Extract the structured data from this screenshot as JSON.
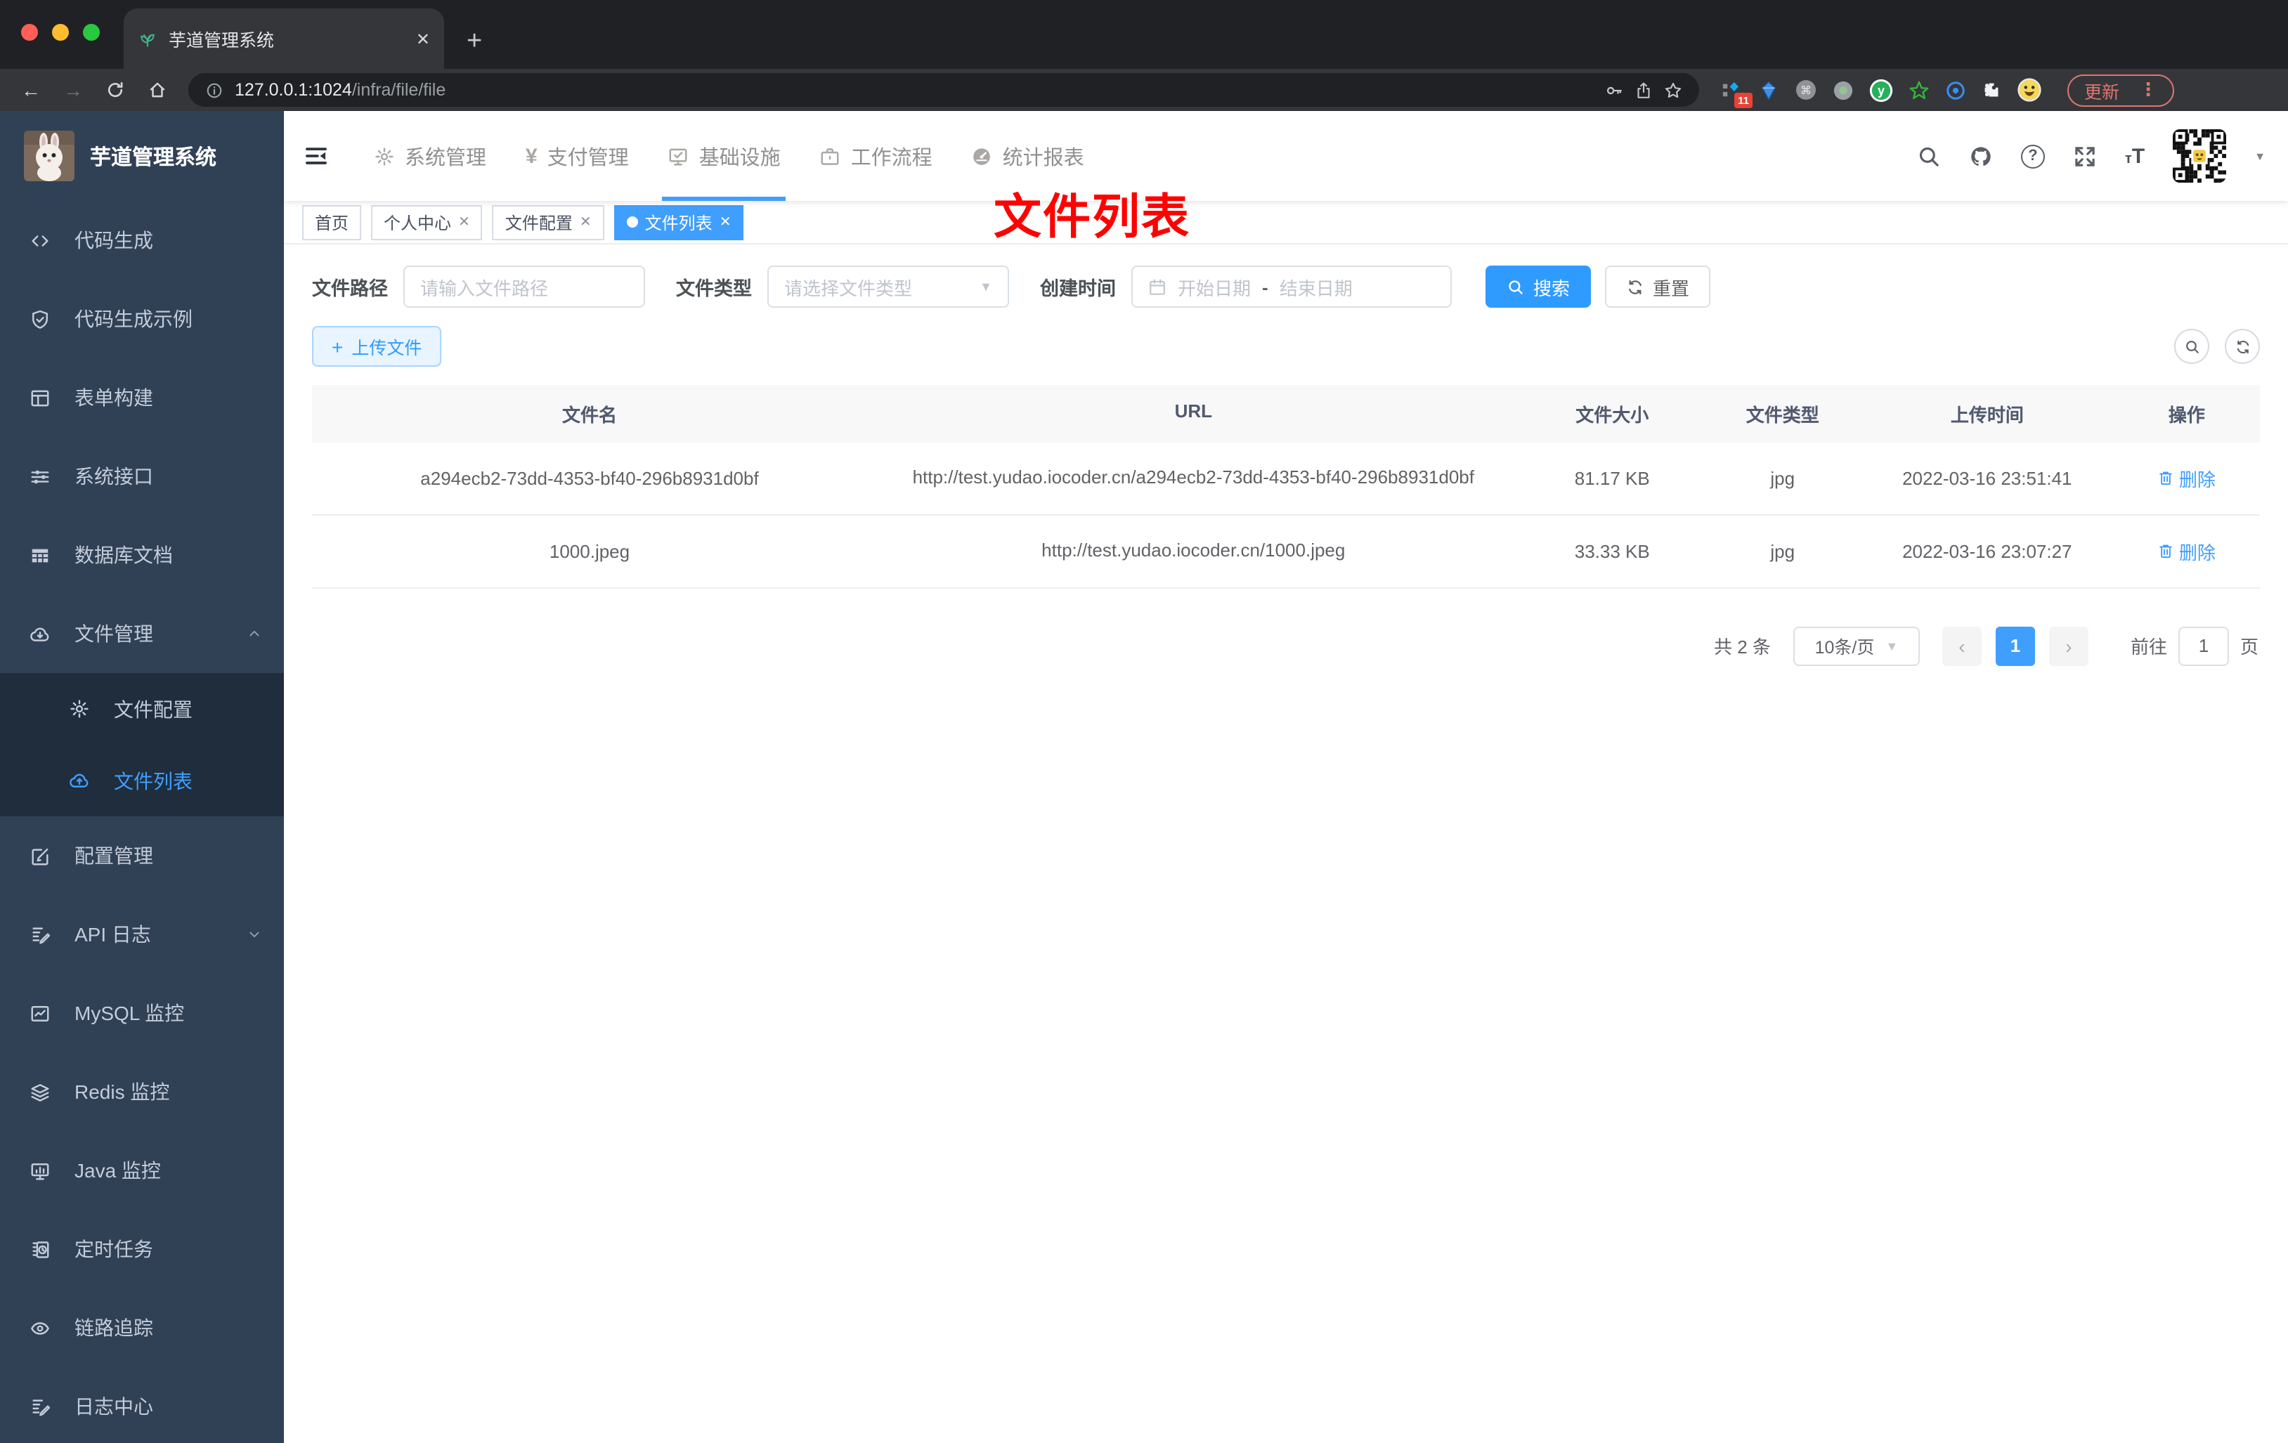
{
  "browser": {
    "tab_title": "芋道管理系统",
    "url_host": "127.0.0.1:1024",
    "url_path": "/infra/file/file",
    "ext_badge": "11",
    "update_label": "更新",
    "traffic_colors": [
      "#ff5f57",
      "#febc2e",
      "#28c840"
    ]
  },
  "sidebar": {
    "title": "芋道管理系统",
    "items": [
      {
        "id": "code-gen",
        "label": "代码生成",
        "icon": "code-icon"
      },
      {
        "id": "code-demo",
        "label": "代码生成示例",
        "icon": "shield-check-icon"
      },
      {
        "id": "form-build",
        "label": "表单构建",
        "icon": "form-icon"
      },
      {
        "id": "sys-api",
        "label": "系统接口",
        "icon": "sliders-icon"
      },
      {
        "id": "db-doc",
        "label": "数据库文档",
        "icon": "grid-icon"
      },
      {
        "id": "file-mgr",
        "label": "文件管理",
        "icon": "cloud-download-icon",
        "chevron": "up",
        "children": [
          {
            "id": "file-config",
            "label": "文件配置",
            "icon": "gear-icon"
          },
          {
            "id": "file-list",
            "label": "文件列表",
            "icon": "cloud-upload-icon",
            "active": true
          }
        ]
      },
      {
        "id": "config-mgr",
        "label": "配置管理",
        "icon": "edit-icon"
      },
      {
        "id": "api-log",
        "label": "API 日志",
        "icon": "log-edit-icon",
        "chevron": "down"
      },
      {
        "id": "mysql",
        "label": "MySQL 监控",
        "icon": "chart-box-icon"
      },
      {
        "id": "redis",
        "label": "Redis 监控",
        "icon": "layers-icon"
      },
      {
        "id": "java",
        "label": "Java 监控",
        "icon": "monitor-bars-icon"
      },
      {
        "id": "job",
        "label": "定时任务",
        "icon": "task-clock-icon"
      },
      {
        "id": "trace",
        "label": "链路追踪",
        "icon": "eye-icon"
      },
      {
        "id": "log-center",
        "label": "日志中心",
        "icon": "log-edit-icon"
      }
    ]
  },
  "header": {
    "nav": [
      {
        "id": "system",
        "label": "系统管理",
        "icon": "gear-icon"
      },
      {
        "id": "pay",
        "label": "支付管理",
        "icon": "yen-icon"
      },
      {
        "id": "infra",
        "label": "基础设施",
        "icon": "monitor-check-icon",
        "active": true
      },
      {
        "id": "workflow",
        "label": "工作流程",
        "icon": "briefcase-icon"
      },
      {
        "id": "report",
        "label": "统计报表",
        "icon": "gauge-icon"
      }
    ],
    "right_icons": [
      "search-icon",
      "github-icon",
      "question-icon",
      "fullscreen-icon",
      "font-size-icon",
      "qr-avatar",
      "caret-down-icon"
    ]
  },
  "tags": [
    {
      "label": "首页",
      "closable": false,
      "active": false
    },
    {
      "label": "个人中心",
      "closable": true,
      "active": false
    },
    {
      "label": "文件配置",
      "closable": true,
      "active": false
    },
    {
      "label": "文件列表",
      "closable": true,
      "active": true
    }
  ],
  "annotation": {
    "text": "文件列表"
  },
  "filters": {
    "path_label": "文件路径",
    "path_placeholder": "请输入文件路径",
    "type_label": "文件类型",
    "type_placeholder": "请选择文件类型",
    "date_label": "创建时间",
    "date_start": "开始日期",
    "date_separator": "-",
    "date_end": "结束日期",
    "search_label": "搜索",
    "reset_label": "重置"
  },
  "actions": {
    "upload_label": "上传文件",
    "upload_plus": "+"
  },
  "table": {
    "columns": [
      "文件名",
      "URL",
      "文件大小",
      "文件类型",
      "上传时间",
      "操作"
    ],
    "rows": [
      {
        "name": "a294ecb2-73dd-4353-bf40-296b8931d0bf",
        "url": "http://test.yudao.iocoder.cn/a294ecb2-73dd-4353-bf40-296b8931d0bf",
        "size": "81.17 KB",
        "type": "jpg",
        "time": "2022-03-16 23:51:41",
        "action": "删除"
      },
      {
        "name": "1000.jpeg",
        "url": "http://test.yudao.iocoder.cn/1000.jpeg",
        "size": "33.33 KB",
        "type": "jpg",
        "time": "2022-03-16 23:07:27",
        "action": "删除"
      }
    ]
  },
  "pagination": {
    "total": "共 2 条",
    "page_size": "10条/页",
    "prev": "‹",
    "next": "›",
    "current_page": "1",
    "goto_label": "前往",
    "goto_value": "1",
    "goto_suffix": "页"
  },
  "colors": {
    "accent": "#409eff",
    "search_button": "#2f9bff",
    "sidebar_bg": "#304156",
    "submenu_bg": "#1f2d3d",
    "sidebar_text": "#c4ccd9",
    "annotation_red": "#fe0100",
    "chrome_bg": "#202124",
    "toolbar_bg": "#35363a",
    "update_red": "#df766f",
    "upload_bg": "#e8f4ff",
    "table_header_bg": "#f8f8f9"
  }
}
